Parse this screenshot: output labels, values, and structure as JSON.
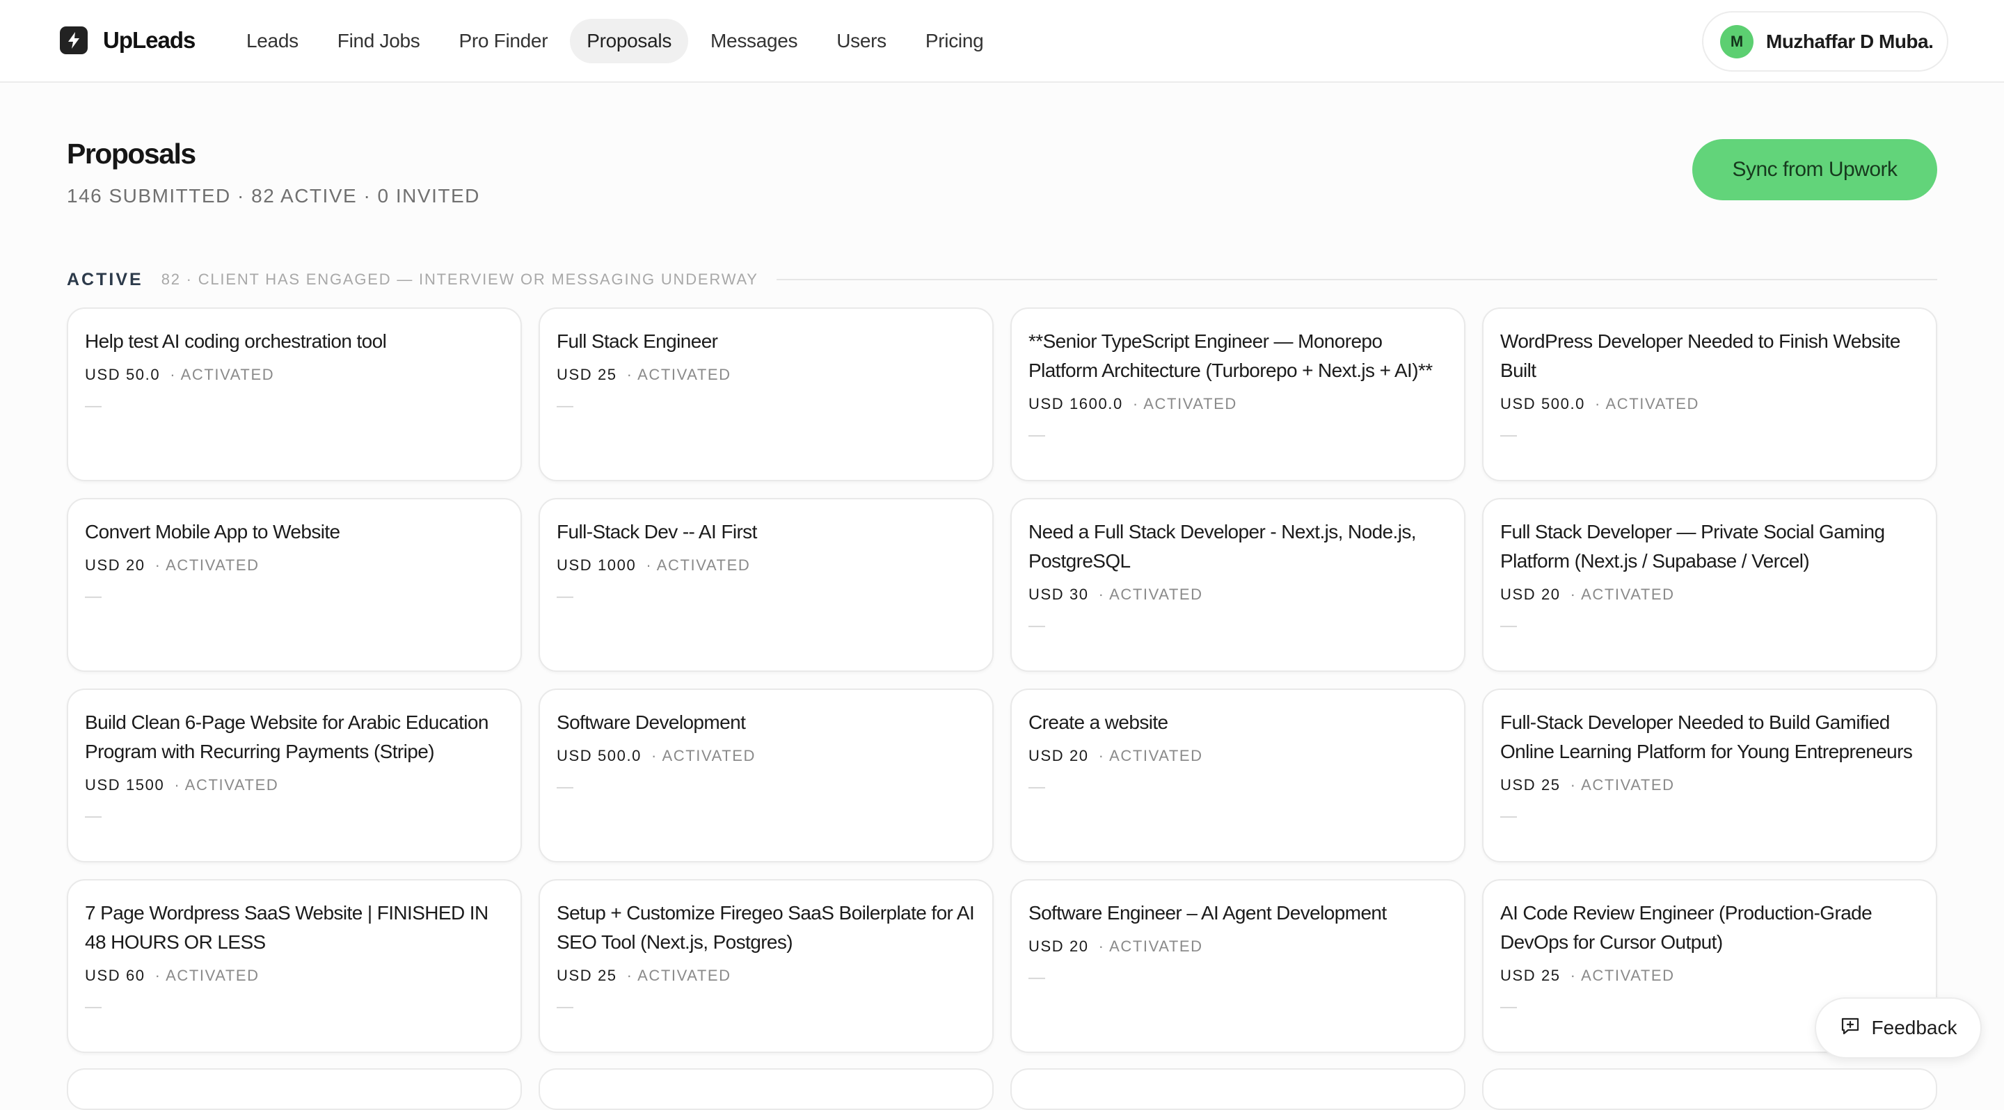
{
  "app": {
    "name": "UpLeads"
  },
  "nav": {
    "items": [
      {
        "label": "Leads",
        "active": false
      },
      {
        "label": "Find Jobs",
        "active": false
      },
      {
        "label": "Pro Finder",
        "active": false
      },
      {
        "label": "Proposals",
        "active": true
      },
      {
        "label": "Messages",
        "active": false
      },
      {
        "label": "Users",
        "active": false
      },
      {
        "label": "Pricing",
        "active": false
      }
    ]
  },
  "user": {
    "initial": "M",
    "name": "Muzhaffar D Muba..."
  },
  "header": {
    "title": "Proposals",
    "stats": "146 SUBMITTED · 82 ACTIVE · 0 INVITED",
    "sync_label": "Sync from Upwork"
  },
  "section": {
    "label": "ACTIVE",
    "desc": "82 · CLIENT HAS ENGAGED — INTERVIEW OR MESSAGING UNDERWAY"
  },
  "cards": [
    {
      "title": "Help test AI coding orchestration tool",
      "price": "USD 50.0",
      "status": "· ACTIVATED",
      "note": "—"
    },
    {
      "title": "Full Stack Engineer",
      "price": "USD 25",
      "status": "· ACTIVATED",
      "note": "—"
    },
    {
      "title": "**Senior TypeScript Engineer — Monorepo Platform Architecture (Turborepo + Next.js + AI)**",
      "price": "USD 1600.0",
      "status": "· ACTIVATED",
      "note": "—"
    },
    {
      "title": "WordPress Developer Needed to Finish Website Built",
      "price": "USD 500.0",
      "status": "· ACTIVATED",
      "note": "—"
    },
    {
      "title": "Convert Mobile App to Website",
      "price": "USD 20",
      "status": "· ACTIVATED",
      "note": "—"
    },
    {
      "title": "Full-Stack Dev -- AI First",
      "price": "USD 1000",
      "status": "· ACTIVATED",
      "note": "—"
    },
    {
      "title": "Need a Full Stack Developer - Next.js, Node.js, PostgreSQL",
      "price": "USD 30",
      "status": "· ACTIVATED",
      "note": "—"
    },
    {
      "title": "Full Stack Developer — Private Social Gaming Platform (Next.js / Supabase / Vercel)",
      "price": "USD 20",
      "status": "· ACTIVATED",
      "note": "—"
    },
    {
      "title": "Build Clean 6-Page Website for Arabic Education Program with Recurring Payments (Stripe)",
      "price": "USD 1500",
      "status": "· ACTIVATED",
      "note": "—"
    },
    {
      "title": "Software Development",
      "price": "USD 500.0",
      "status": "· ACTIVATED",
      "note": "—"
    },
    {
      "title": "Create a website",
      "price": "USD 20",
      "status": "· ACTIVATED",
      "note": "—"
    },
    {
      "title": "Full-Stack Developer Needed to Build Gamified Online Learning Platform for Young Entrepreneurs",
      "price": "USD 25",
      "status": "· ACTIVATED",
      "note": "—"
    },
    {
      "title": "7 Page Wordpress SaaS Website | FINISHED IN 48 HOURS OR LESS",
      "price": "USD 60",
      "status": "· ACTIVATED",
      "note": "—"
    },
    {
      "title": "Setup + Customize Firegeo SaaS Boilerplate for AI SEO Tool (Next.js, Postgres)",
      "price": "USD 25",
      "status": "· ACTIVATED",
      "note": "—"
    },
    {
      "title": "Software Engineer – AI Agent Development",
      "price": "USD 20",
      "status": "· ACTIVATED",
      "note": "—"
    },
    {
      "title": "AI Code Review Engineer (Production-Grade DevOps for Cursor Output)",
      "price": "USD 25",
      "status": "· ACTIVATED",
      "note": "—"
    }
  ],
  "feedback": {
    "label": "Feedback"
  },
  "colors": {
    "accent": "#62d47a",
    "avatar": "#5ccf71"
  }
}
